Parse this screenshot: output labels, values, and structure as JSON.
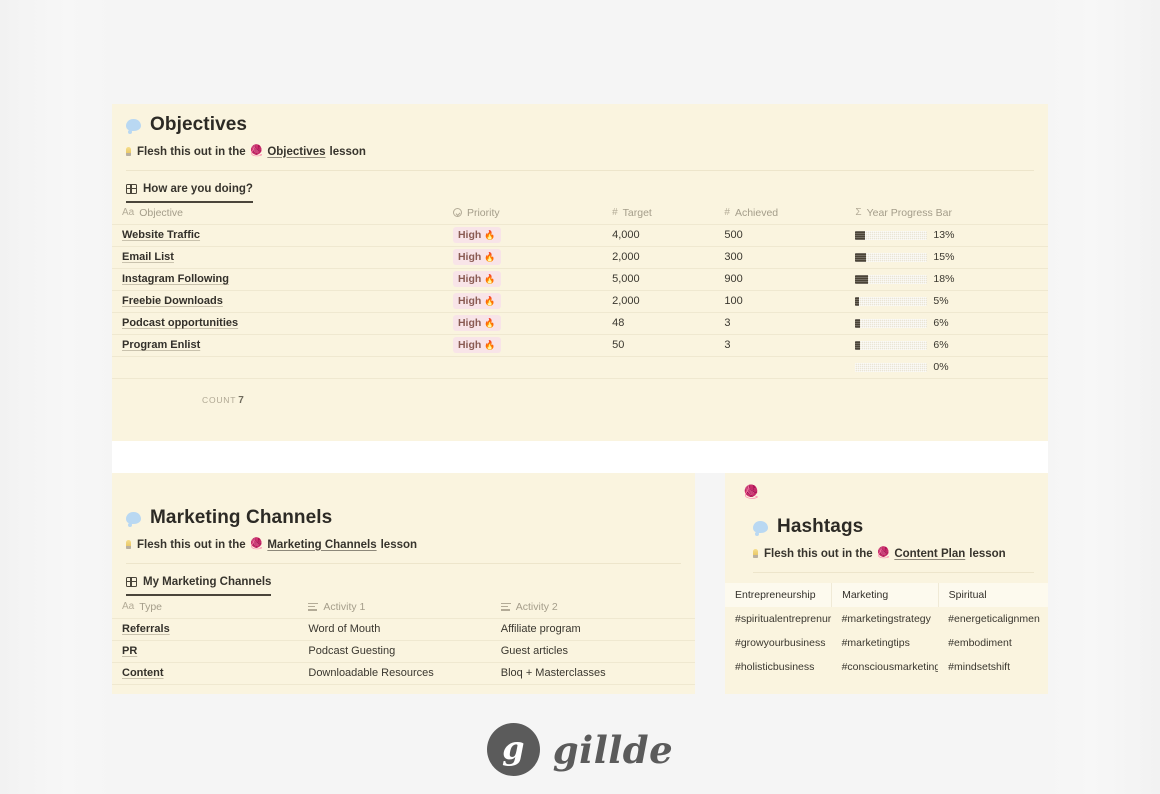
{
  "objectives": {
    "title": "Objectives",
    "bubble_icon": "speech-bubble-emoji",
    "subtitle_prefix": "Flesh this out in the",
    "subtitle_link": "Objectives",
    "subtitle_suffix": "lesson",
    "bulb_icon": "lightbulb-emoji",
    "wand_icon": "magic-wand-emoji",
    "tab": {
      "label": "How are you doing?",
      "icon": "grid-table-icon"
    },
    "columns": [
      {
        "label": "Objective",
        "icon": "Aa"
      },
      {
        "label": "Priority",
        "icon": "circle-chevron-icon"
      },
      {
        "label": "Target",
        "icon": "#"
      },
      {
        "label": "Achieved",
        "icon": "#"
      },
      {
        "label": "Year Progress Bar",
        "icon": "Σ"
      }
    ],
    "rows": [
      {
        "name": "Website Traffic",
        "priority": "High",
        "target": "4,000",
        "achieved": "500",
        "pct": "13%",
        "pct_value": 13
      },
      {
        "name": "Email List",
        "priority": "High",
        "target": "2,000",
        "achieved": "300",
        "pct": "15%",
        "pct_value": 15
      },
      {
        "name": "Instagram Following",
        "priority": "High",
        "target": "5,000",
        "achieved": "900",
        "pct": "18%",
        "pct_value": 18
      },
      {
        "name": "Freebie Downloads",
        "priority": "High",
        "target": "2,000",
        "achieved": "100",
        "pct": "5%",
        "pct_value": 5
      },
      {
        "name": "Podcast opportunities",
        "priority": "High",
        "target": "48",
        "achieved": "3",
        "pct": "6%",
        "pct_value": 6
      },
      {
        "name": "Program Enlist",
        "priority": "High",
        "target": "50",
        "achieved": "3",
        "pct": "6%",
        "pct_value": 6
      },
      {
        "name": "",
        "priority": "",
        "target": "",
        "achieved": "",
        "pct": "0%",
        "pct_value": 0
      }
    ],
    "priority_emoji": "🔥",
    "count_label": "COUNT",
    "count_value": "7"
  },
  "marketing": {
    "title": "Marketing Channels",
    "subtitle_prefix": "Flesh this out in the",
    "subtitle_link": "Marketing Channels",
    "subtitle_suffix": "lesson",
    "tab": {
      "label": "My Marketing Channels",
      "icon": "grid-table-icon"
    },
    "columns": [
      {
        "label": "Type",
        "icon": "Aa"
      },
      {
        "label": "Activity 1",
        "icon": "text-lines-icon"
      },
      {
        "label": "Activity 2",
        "icon": "text-lines-icon"
      }
    ],
    "rows": [
      {
        "type": "Referrals",
        "activity1": "Word of Mouth",
        "activity2": "Affiliate program"
      },
      {
        "type": "PR",
        "activity1": "Podcast Guesting",
        "activity2": "Guest articles"
      },
      {
        "type": "Content",
        "activity1": "Downloadable Resources",
        "activity2": "Bloq + Masterclasses"
      }
    ]
  },
  "hashtags": {
    "corner_icon": "magic-wand-icon",
    "title": "Hashtags",
    "subtitle_prefix": "Flesh this out in the",
    "subtitle_link": "Content Plan",
    "subtitle_suffix": "lesson",
    "columns": [
      "Entrepreneurship",
      "Marketing",
      "Spiritual"
    ],
    "rows": [
      [
        "#spiritualentreprenur",
        "#marketingstrategy",
        "#energeticalignmen"
      ],
      [
        "#growyourbusiness",
        "#marketingtips",
        "#embodiment"
      ],
      [
        "#holisticbusiness",
        "#consciousmarketing",
        "#mindsetshift"
      ]
    ]
  },
  "footer": {
    "logo_mark": "g",
    "logo_text": "gillde"
  },
  "colors": {
    "panel_bg": "#faf4df",
    "page_bg": "#f5f5f5",
    "pill_bg": "#f8e4e8",
    "pill_text": "#8a5b53",
    "progress_fill": "#4a4336",
    "progress_track": "#eae5d4",
    "logo": "#5b5b5b"
  }
}
